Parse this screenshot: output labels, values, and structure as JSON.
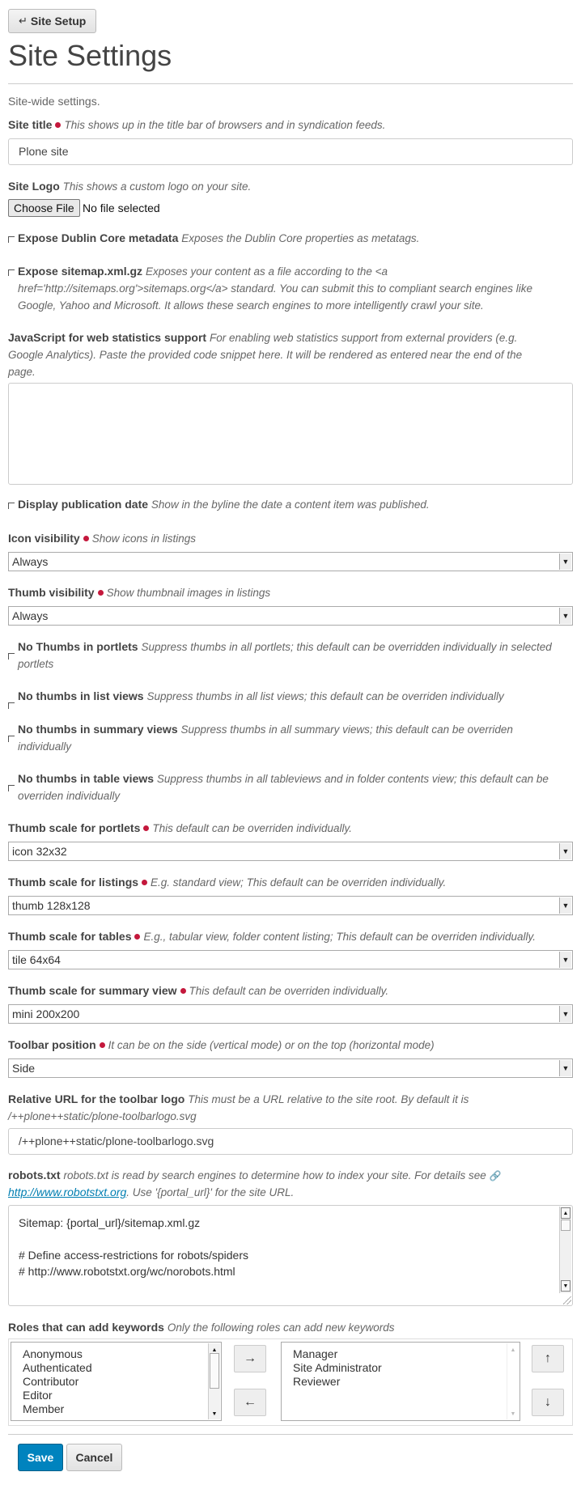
{
  "header": {
    "back_button": "Site Setup",
    "back_icon": "↵",
    "title": "Site Settings",
    "description": "Site-wide settings."
  },
  "fields": {
    "site_title": {
      "label": "Site title",
      "help": "This shows up in the title bar of browsers and in syndication feeds.",
      "value": "Plone site"
    },
    "site_logo": {
      "label": "Site Logo",
      "help": "This shows a custom logo on your site.",
      "button": "Choose File",
      "status": "No file selected"
    },
    "expose_dublin_core": {
      "label": "Expose Dublin Core metadata",
      "help": "Exposes the Dublin Core properties as metatags."
    },
    "expose_sitemap": {
      "label": "Expose sitemap.xml.gz",
      "help_line1": "Exposes your content as a file according to the <a",
      "help_line2": "href='http://sitemaps.org'>sitemaps.org</a> standard. You can submit this to compliant search engines like",
      "help_line3": "Google, Yahoo and Microsoft. It allows these search engines to more intelligently crawl your site."
    },
    "webstats_js": {
      "label": "JavaScript for web statistics support",
      "help_line1": "For enabling web statistics support from external providers (e.g.",
      "help_line2": "Google Analytics). Paste the provided code snippet here. It will be rendered as entered near the end of the",
      "help_line3": "page.",
      "value": ""
    },
    "display_pub_date": {
      "label": "Display publication date",
      "help": "Show in the byline the date a content item was published."
    },
    "icon_visibility": {
      "label": "Icon visibility",
      "help": "Show icons in listings",
      "value": "Always"
    },
    "thumb_visibility": {
      "label": "Thumb visibility",
      "help": "Show thumbnail images in listings",
      "value": "Always"
    },
    "no_thumbs_portlets": {
      "label": "No Thumbs in portlets",
      "help_line1": "Suppress thumbs in all portlets; this default can be overridden individually in selected",
      "help_line2": "portlets"
    },
    "no_thumbs_lists": {
      "label": "No thumbs in list views",
      "help": "Suppress thumbs in all list views; this default can be overriden individually"
    },
    "no_thumbs_summary": {
      "label": "No thumbs in summary views",
      "help_line1": "Suppress thumbs in all summary views; this default can be overriden",
      "help_line2": "individually"
    },
    "no_thumbs_tables": {
      "label": "No thumbs in table views",
      "help_line1": "Suppress thumbs in all tableviews and in folder contents view; this default can be",
      "help_line2": "overriden individually"
    },
    "thumb_scale_portlets": {
      "label": "Thumb scale for portlets",
      "help": "This default can be overriden individually.",
      "value": "icon 32x32"
    },
    "thumb_scale_listings": {
      "label": "Thumb scale for listings",
      "help": "E.g. standard view; This default can be overriden individually.",
      "value": "thumb 128x128"
    },
    "thumb_scale_tables": {
      "label": "Thumb scale for tables",
      "help": "E.g., tabular view, folder content listing; This default can be overriden individually.",
      "value": "tile 64x64"
    },
    "thumb_scale_summary": {
      "label": "Thumb scale for summary view",
      "help": "This default can be overriden individually.",
      "value": "mini 200x200"
    },
    "toolbar_position": {
      "label": "Toolbar position",
      "help": "It can be on the side (vertical mode) or on the top (horizontal mode)",
      "value": "Side"
    },
    "toolbar_logo": {
      "label": "Relative URL for the toolbar logo",
      "help_line1": "This must be a URL relative to the site root. By default it is",
      "help_line2": "/++plone++static/plone-toolbarlogo.svg",
      "value": "/++plone++static/plone-toolbarlogo.svg"
    },
    "robots_txt": {
      "label": "robots.txt",
      "help_line1": "robots.txt is read by search engines to determine how to index your site. For details see",
      "link": "http://www.robotstxt.org",
      "help_line2_rest": ". Use '{portal_url}' for the site URL.",
      "lines": [
        "Sitemap: {portal_url}/sitemap.xml.gz",
        "",
        "# Define access-restrictions for robots/spiders",
        "# http://www.robotstxt.org/wc/norobots.html"
      ]
    },
    "roles_keywords": {
      "label": "Roles that can add keywords",
      "help": "Only the following roles can add new keywords",
      "available": [
        "Anonymous",
        "Authenticated",
        "Contributor",
        "Editor",
        "Member"
      ],
      "selected": [
        "Manager",
        "Site Administrator",
        "Reviewer"
      ],
      "btn_right": "→",
      "btn_left": "←",
      "btn_up": "↑",
      "btn_down": "↓"
    }
  },
  "actions": {
    "save": "Save",
    "cancel": "Cancel"
  },
  "colors": {
    "required_dot": "#c4183c",
    "primary_button": "#0083be",
    "link": "#007eb1"
  }
}
